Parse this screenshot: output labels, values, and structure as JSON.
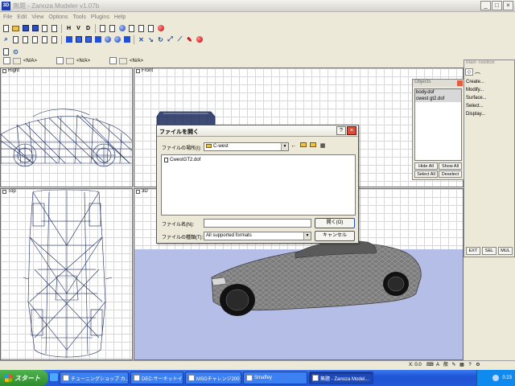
{
  "window": {
    "icon": "3D",
    "title": "無題 - Zanoza Modeler v1.07b",
    "controls": [
      "_",
      "□",
      "×"
    ]
  },
  "menu": [
    "File",
    "Edit",
    "View",
    "Options",
    "Tools",
    "Plugins",
    "Help"
  ],
  "toolbar": {
    "letters": [
      "H",
      "V",
      "D"
    ]
  },
  "selectors": [
    "<N/A>",
    "<N/A>",
    "<N/A>"
  ],
  "viewports": {
    "right": "Right",
    "front": "Front",
    "top": "Top",
    "persp": "3D"
  },
  "objects_panel": {
    "title": "Objects",
    "items": [
      "body.dof",
      "cwest gt2.dof"
    ],
    "buttons": [
      "Hide All",
      "Show All",
      "Select All",
      "Deselect"
    ]
  },
  "toolbox": {
    "title": "Main ToolBox",
    "menu": [
      "Create...",
      "Modify...",
      "Surface...",
      "Select...",
      "Display..."
    ],
    "bottom": [
      "EXT",
      "SEL",
      "MUL"
    ]
  },
  "dialog": {
    "title": "ファイルを開く",
    "help": "?",
    "close": "×",
    "location_label": "ファイルの場所(I):",
    "location_value": "C-west",
    "files": [
      "CwestGT2.dof"
    ],
    "filename_label": "ファイル名(N):",
    "filename_value": "",
    "filetype_label": "ファイルの種類(T):",
    "filetype_value": "All supported formats",
    "open_button": "開く(O)",
    "cancel_button": "キャンセル"
  },
  "statusbar": {
    "coord": "X: 0.0"
  },
  "taskbar": {
    "start": "スタート",
    "tasks": [
      {
        "label": "チューニングショップ カ...",
        "active": false
      },
      {
        "label": "DEC-サーキットイベント...",
        "active": false
      },
      {
        "label": "MSGチャレンジ2007 結...",
        "active": false
      },
      {
        "label": "Smaffey",
        "active": false
      },
      {
        "label": "無題 - Zanoza Model...",
        "active": true
      }
    ],
    "clock": "0:23"
  },
  "colors": {
    "wire": "#1a2a5c",
    "mesh": "#6e6e6e",
    "persp_bg": "#b5bee6",
    "taskbar": "#2459d8"
  }
}
